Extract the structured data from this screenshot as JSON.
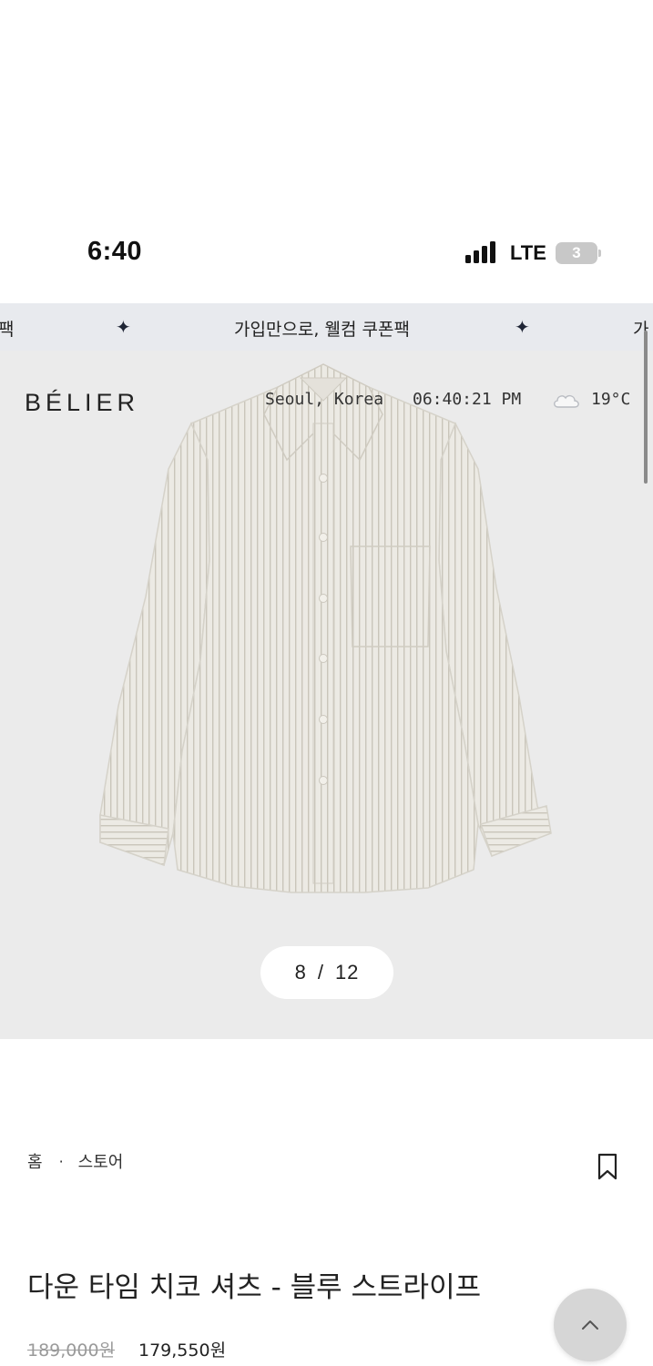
{
  "status_bar": {
    "time": "6:40",
    "network": "LTE",
    "battery": "3"
  },
  "announcement": {
    "left_fragment": "팩",
    "text": "가입만으로, 웰컴 쿠폰팩",
    "right_fragment": "가",
    "sparkle_icon": "sparkle-icon"
  },
  "header": {
    "brand": "BÉLIER",
    "location": "Seoul, Korea",
    "time": "06:40:21 PM",
    "weather_icon": "cloud-icon",
    "temperature": "19°C"
  },
  "gallery": {
    "current": "8",
    "separator": "/",
    "total": "12"
  },
  "breadcrumb": {
    "home": "홈",
    "separator": "·",
    "store": "스토어"
  },
  "product": {
    "title": "다운 타임 치코 셔츠 - 블루 스트라이프",
    "original_price": "189,000원",
    "sale_price": "179,550원"
  },
  "colors": {
    "hero_background": "#ebebeb",
    "banner_background": "#e8eaee",
    "shirt": "#e9e7e1",
    "stripe": "#c4c0b4"
  }
}
